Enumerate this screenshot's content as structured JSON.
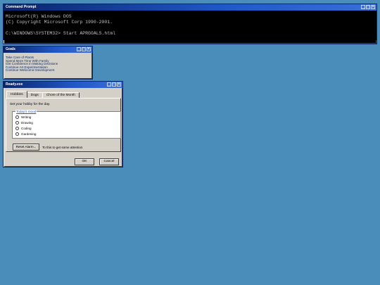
{
  "cmd": {
    "title": "Command Prompt",
    "lines": [
      "Microsoft(R) Windows DOS",
      "(C) Copyright Microsoft Corp 1990-2001.",
      "",
      "C:\\WINDOWS\\SYSTEM32> Start APRGOALS.html"
    ]
  },
  "goals": {
    "title": "Goals",
    "items": [
      "Take Care of Plants",
      "Spend More Time With Family",
      "Get Confidence in Making Decisions",
      "Continue Art Experimentation",
      "Continue Webcomic Development"
    ]
  },
  "ready": {
    "title": "Ready.exe",
    "tabs": [
      "Hobbies",
      "Dogs",
      "Chore of the Month"
    ],
    "prompt": "Set your hobby for the day.",
    "legend": "Today's mood",
    "options": [
      "Writing",
      "Drawing",
      "Coding",
      "Gardening"
    ],
    "reset_label": "Reset Alarm...",
    "reset_note": "To this to get some attention",
    "ok_label": "OK",
    "cancel_label": "Cancel"
  },
  "colors": {
    "desktop": "#4a8cba",
    "titlebar": "#0a246a",
    "window": "#d4d0c8",
    "link": "#1a56c6"
  },
  "icons": [
    "minimize-icon",
    "maximize-icon",
    "close-icon"
  ]
}
